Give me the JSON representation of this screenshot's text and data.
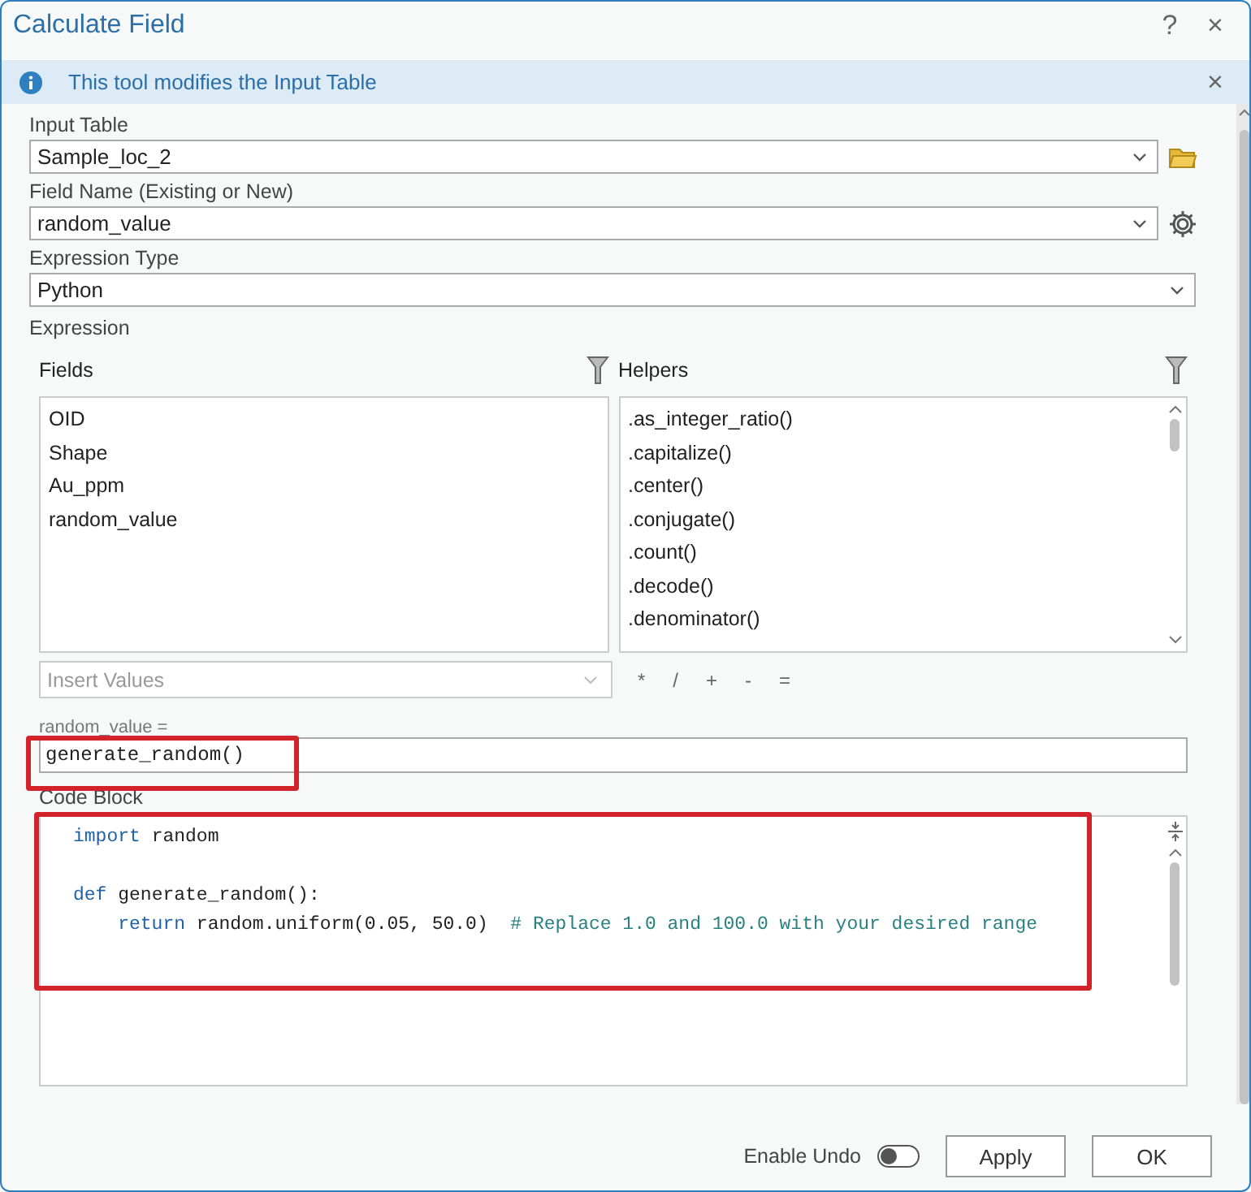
{
  "window": {
    "title": "Calculate Field",
    "help": "?",
    "close": "×"
  },
  "info_bar": {
    "message": "This tool modifies the Input Table",
    "close": "×"
  },
  "input_table": {
    "label": "Input Table",
    "value": "Sample_loc_2"
  },
  "field_name": {
    "label": "Field Name (Existing or New)",
    "value": "random_value"
  },
  "expression_type": {
    "label": "Expression Type",
    "value": "Python"
  },
  "expression": {
    "label": "Expression",
    "fields": {
      "title": "Fields",
      "items": [
        "OID",
        "Shape",
        "Au_ppm",
        "random_value"
      ]
    },
    "helpers": {
      "title": "Helpers",
      "items": [
        ".as_integer_ratio()",
        ".capitalize()",
        ".center()",
        ".conjugate()",
        ".count()",
        ".decode()",
        ".denominator()"
      ]
    },
    "insert_values": {
      "placeholder": "Insert Values"
    },
    "operators": [
      "*",
      "/",
      "+",
      "-",
      "="
    ],
    "target_label": "random_value =",
    "value": "generate_random()"
  },
  "code_block": {
    "label": "Code Block",
    "lines": [
      {
        "kind": "code",
        "indented": false,
        "tokens": [
          {
            "kind": "keyword",
            "text": "import"
          },
          {
            "kind": "plain",
            "text": " random"
          }
        ]
      },
      {
        "kind": "blank"
      },
      {
        "kind": "code",
        "indented": false,
        "tokens": [
          {
            "kind": "keyword",
            "text": "def"
          },
          {
            "kind": "plain",
            "text": " generate_random():"
          }
        ]
      },
      {
        "kind": "code",
        "indented": true,
        "tokens": [
          {
            "kind": "keyword",
            "text": "return"
          },
          {
            "kind": "plain",
            "text": " random.uniform(0.05, 50.0)  "
          },
          {
            "kind": "comment",
            "text": "# Replace 1.0 and 100.0 with your desired range"
          }
        ]
      }
    ]
  },
  "footer": {
    "enable_undo": {
      "label": "Enable Undo",
      "on": false
    },
    "buttons": [
      "Apply",
      "OK"
    ]
  }
}
